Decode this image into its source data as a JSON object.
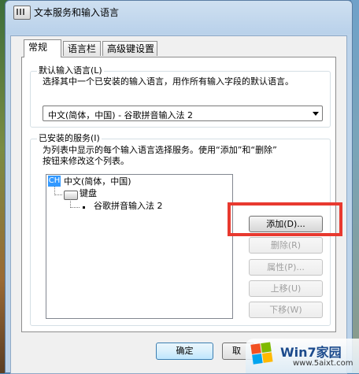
{
  "window": {
    "title": "文本服务和输入语言"
  },
  "tabs": [
    {
      "label": "常规",
      "active": true
    },
    {
      "label": "语言栏",
      "active": false
    },
    {
      "label": "高级键设置",
      "active": false
    }
  ],
  "default_language": {
    "group_label": "默认输入语言(L)",
    "description": "选择其中一个已安装的输入语言，用作所有输入字段的默认语言。",
    "selected": "中文(简体，中国) - 谷歌拼音输入法 2"
  },
  "installed_services": {
    "group_label": "已安装的服务(I)",
    "description_line1": "为列表中显示的每个输入语言选择服务。使用“添加”和“删除”",
    "description_line2": "按钮来修改这个列表。",
    "tree": {
      "language_badge": "CH",
      "language": "中文(简体，中国)",
      "category": "键盘",
      "service": "谷歌拼音输入法 2"
    },
    "buttons": {
      "add": "添加(D)...",
      "remove": "删除(R)",
      "properties": "属性(P)...",
      "move_up": "上移(U)",
      "move_down": "下移(W)"
    }
  },
  "footer": {
    "ok": "确定",
    "cancel": "取"
  },
  "watermark": {
    "title": "Win7家园",
    "url": "www.5aixt.com"
  },
  "colors": {
    "highlight": "#e8392f",
    "selection": "#3399ff"
  }
}
